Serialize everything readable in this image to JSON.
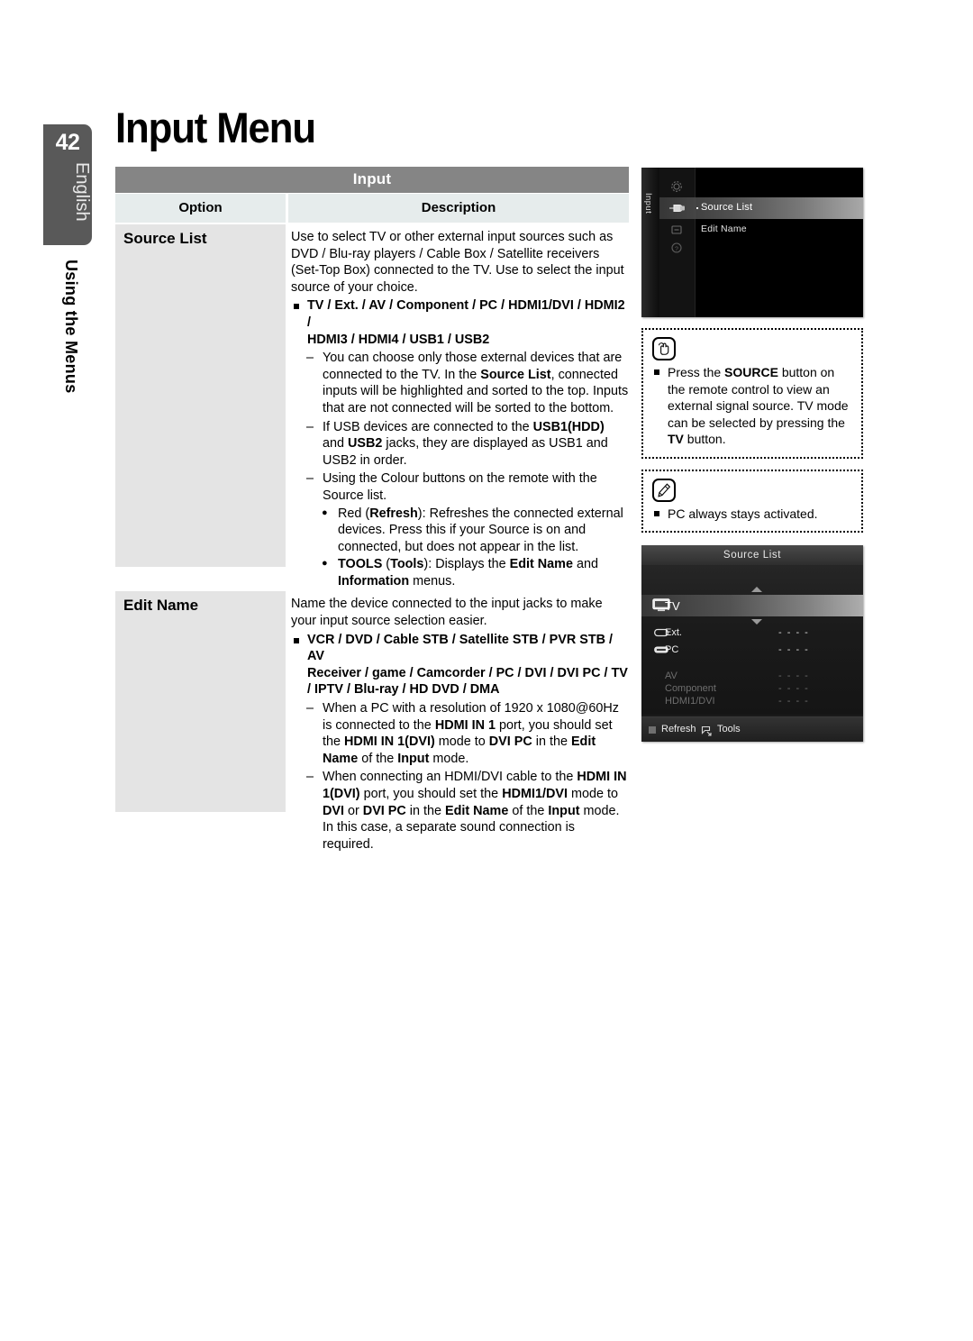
{
  "sidebar": {
    "page_number": "42",
    "language": "English",
    "section": "Using the Menus"
  },
  "page_title": "Input Menu",
  "table": {
    "title": "Input",
    "headers": {
      "option": "Option",
      "description": "Description"
    },
    "rows": [
      {
        "option": "Source List",
        "description": {
          "intro": "Use to select TV or other external input sources such as DVD / Blu-ray players / Cable Box / Satellite receivers (Set-Top Box) connected to the TV. Use to select the input source of your choice.",
          "square_1a": "TV / Ext. / AV / Component / PC / HDMI1/DVI / HDMI2 /",
          "square_1b": "HDMI3 / HDMI4 / USB1 / USB2",
          "dash_1_a": "You can choose only those external devices that are connected to the TV. In the ",
          "dash_1_b": "Source List",
          "dash_1_c": ", connected inputs will be highlighted and sorted to the top. Inputs that are not connected will be sorted to the bottom.",
          "dash_2_a": "If USB devices are connected to the ",
          "dash_2_b": "USB1(HDD)",
          "dash_2_c": " and ",
          "dash_2_d": "USB2",
          "dash_2_e": " jacks, they are displayed as USB1 and USB2 in order.",
          "dash_3": "Using the Colour buttons on the remote with the Source list.",
          "dot_1_a": "Red (",
          "dot_1_b": "Refresh",
          "dot_1_c": "): Refreshes the connected external devices. Press this if your Source is on and connected, but does not appear in the list.",
          "dot_2_a": "TOOLS",
          "dot_2_b": " (",
          "dot_2_c": "Tools",
          "dot_2_d": "): Displays the ",
          "dot_2_e": "Edit Name",
          "dot_2_f": " and ",
          "dot_2_g": "Information",
          "dot_2_h": " menus."
        }
      },
      {
        "option": "Edit Name",
        "description": {
          "intro": "Name the device connected to the input jacks to make your input source selection easier.",
          "square_1a": "VCR / DVD / Cable STB / Satellite STB / PVR STB / AV",
          "square_1b": "Receiver / game / Camcorder / PC / DVI / DVI PC / TV",
          "square_1c": "/ IPTV / Blu-ray / HD DVD / DMA",
          "dash_1_a": "When a PC with a resolution of 1920 x 1080@60Hz is connected to the ",
          "dash_1_b": "HDMI IN 1",
          "dash_1_c": " port, you should set the ",
          "dash_1_d": "HDMI IN 1(DVI)",
          "dash_1_e": " mode to ",
          "dash_1_f": "DVI PC",
          "dash_1_g": " in the ",
          "dash_1_h": "Edit Name",
          "dash_1_i": " of the ",
          "dash_1_j": "Input",
          "dash_1_k": " mode.",
          "dash_2_a": "When connecting an HDMI/DVI cable to the ",
          "dash_2_b": "HDMI IN 1(DVI)",
          "dash_2_c": " port, you should set the ",
          "dash_2_d": "HDMI1/DVI",
          "dash_2_e": " mode to ",
          "dash_2_f": "DVI",
          "dash_2_g": " or ",
          "dash_2_h": "DVI PC",
          "dash_2_i": " in the ",
          "dash_2_j": "Edit Name",
          "dash_2_k": " of the ",
          "dash_2_l": "Input",
          "dash_2_m": " mode. In this case, a separate sound connection is required."
        }
      }
    ]
  },
  "osd_input_menu": {
    "vertical_label": "Input",
    "items": [
      "Source List",
      "Edit Name"
    ],
    "icons": [
      "gear-icon",
      "plug-icon",
      "tag-icon",
      "question-icon"
    ]
  },
  "notes": [
    {
      "icon": "hand-press-icon",
      "text_a": "Press the ",
      "text_b": "SOURCE",
      "text_c": " button on the remote control to view an external signal source. TV mode can be selected by pressing the ",
      "text_d": "TV",
      "text_e": " button."
    },
    {
      "icon": "pencil-note-icon",
      "text_a": "PC always stays activated.",
      "text_b": "",
      "text_c": "",
      "text_d": "",
      "text_e": ""
    }
  ],
  "osd_source_list": {
    "title": "Source List",
    "selected": "TV",
    "rows": [
      {
        "label": "Ext.",
        "value": "- - - -",
        "dim": false
      },
      {
        "label": "PC",
        "value": "- - - -",
        "dim": false
      },
      {
        "label": "AV",
        "value": "- - - -",
        "dim": true
      },
      {
        "label": "Component",
        "value": "- - - -",
        "dim": true
      },
      {
        "label": "HDMI1/DVI",
        "value": "- - - -",
        "dim": true
      }
    ],
    "footer": {
      "refresh": "Refresh",
      "tools": "Tools"
    }
  },
  "colors": {
    "table_title_bg": "#858585",
    "table_head_bg": "#e6ecec",
    "option_cell_bg": "#e4e4e4",
    "sidebar_bg": "#595959"
  }
}
